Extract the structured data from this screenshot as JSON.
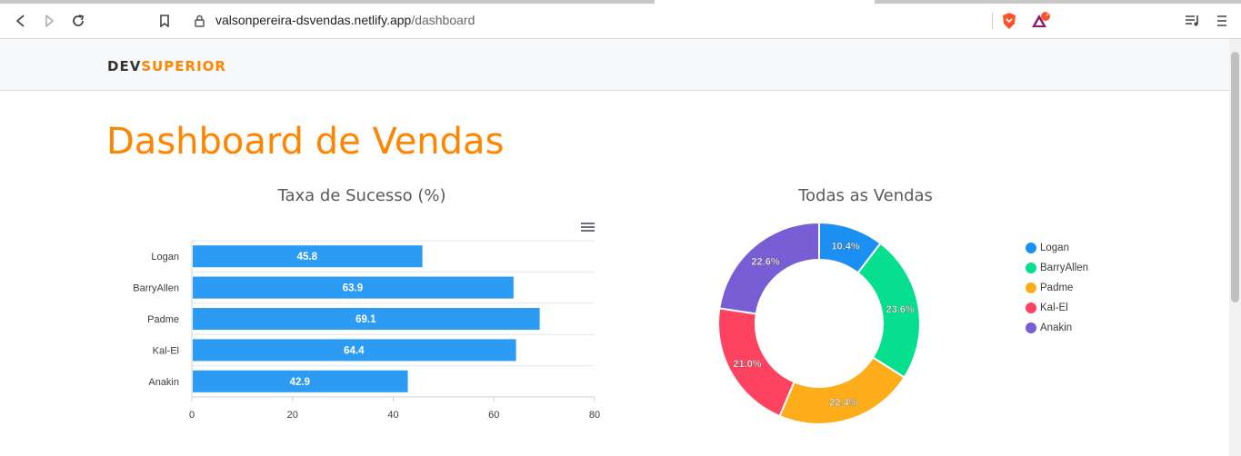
{
  "browser": {
    "url_host": "valsonpereira-dsvendas.netlify.app",
    "url_path": "/dashboard",
    "shield_badge": "1"
  },
  "site": {
    "logo_part1": "DEV",
    "logo_part2": "SUPERIOR",
    "page_title": "Dashboard de Vendas"
  },
  "colors": {
    "accent": "#ff8400",
    "bar": "#2b9bf4"
  },
  "chart_data": [
    {
      "type": "bar",
      "orientation": "horizontal",
      "title": "Taxa de Sucesso (%)",
      "categories": [
        "Logan",
        "BarryAllen",
        "Padme",
        "Kal-El",
        "Anakin"
      ],
      "values": [
        45.8,
        63.9,
        69.1,
        64.4,
        42.9
      ],
      "xlim": [
        0,
        80
      ],
      "xticks": [
        "0",
        "20",
        "40",
        "60",
        "80"
      ],
      "color": "#2b9bf4",
      "grid": "horizontal"
    },
    {
      "type": "pie",
      "variant": "donut",
      "title": "Todas as Vendas",
      "labels": [
        "Logan",
        "BarryAllen",
        "Padme",
        "Kal-El",
        "Anakin"
      ],
      "values": [
        10.4,
        23.6,
        22.4,
        21.0,
        22.6
      ],
      "value_labels": [
        "10.4%",
        "23.6%",
        "22.4%",
        "21.0%",
        "22.6%"
      ],
      "colors": [
        "#1b8ff2",
        "#06e08e",
        "#fdad19",
        "#fe4360",
        "#775ed4"
      ],
      "legend_position": "right"
    }
  ]
}
